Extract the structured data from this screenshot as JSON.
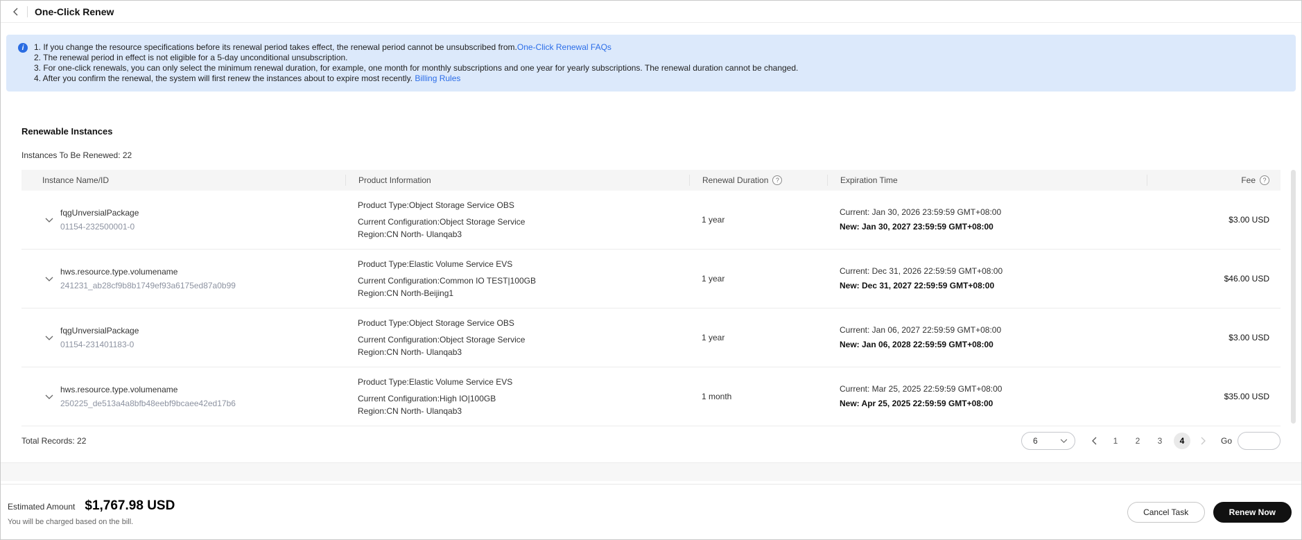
{
  "header": {
    "title": "One-Click Renew"
  },
  "icons": {
    "info": "i",
    "help": "?"
  },
  "notice": {
    "lines": [
      {
        "text": "1. If you change the resource specifications before its renewal period takes effect, the renewal period cannot be unsubscribed from.",
        "link": "One-Click Renewal FAQs"
      },
      {
        "text": "2. The renewal period in effect is not eligible for a 5-day unconditional unsubscription.",
        "link": ""
      },
      {
        "text": "3. For one-click renewals, you can only select the minimum renewal duration, for example, one month for monthly subscriptions and one year for yearly subscriptions. The renewal duration cannot be changed.",
        "link": ""
      },
      {
        "text": "4. After you confirm the renewal, the system will first renew the instances about to expire most recently. ",
        "link": "Billing Rules"
      }
    ]
  },
  "section": {
    "title": "Renewable Instances",
    "subtitle": "Instances To Be Renewed: 22"
  },
  "table": {
    "columns": {
      "name": "Instance Name/ID",
      "product": "Product Information",
      "duration": "Renewal Duration",
      "expiration": "Expiration Time",
      "fee": "Fee"
    },
    "rows": [
      {
        "name": "fqgUnversialPackage",
        "id": "01154-232500001-0",
        "product_type": "Product Type:Object Storage Service OBS",
        "configuration": "Current Configuration:Object Storage Service",
        "region": "Region:CN North- Ulanqab3",
        "duration": "1 year",
        "expiration_current": "Current: Jan 30, 2026 23:59:59 GMT+08:00",
        "expiration_new": "New: Jan 30, 2027 23:59:59 GMT+08:00",
        "fee": "$3.00 USD"
      },
      {
        "name": "hws.resource.type.volumename",
        "id": "241231_ab28cf9b8b1749ef93a6175ed87a0b99",
        "product_type": "Product Type:Elastic Volume Service EVS",
        "configuration": "Current Configuration:Common IO TEST|100GB",
        "region": "Region:CN North-Beijing1",
        "duration": "1 year",
        "expiration_current": "Current: Dec 31, 2026 22:59:59 GMT+08:00",
        "expiration_new": "New: Dec 31, 2027 22:59:59 GMT+08:00",
        "fee": "$46.00 USD"
      },
      {
        "name": "fqgUnversialPackage",
        "id": "01154-231401183-0",
        "product_type": "Product Type:Object Storage Service OBS",
        "configuration": "Current Configuration:Object Storage Service",
        "region": "Region:CN North- Ulanqab3",
        "duration": "1 year",
        "expiration_current": "Current: Jan 06, 2027 22:59:59 GMT+08:00",
        "expiration_new": "New: Jan 06, 2028 22:59:59 GMT+08:00",
        "fee": "$3.00 USD"
      },
      {
        "name": "hws.resource.type.volumename",
        "id": "250225_de513a4a8bfb48eebf9bcaee42ed17b6",
        "product_type": "Product Type:Elastic Volume Service EVS",
        "configuration": "Current Configuration:High IO|100GB",
        "region": "Region:CN North- Ulanqab3",
        "duration": "1 month",
        "expiration_current": "Current: Mar 25, 2025 22:59:59 GMT+08:00",
        "expiration_new": "New: Apr 25, 2025 22:59:59 GMT+08:00",
        "fee": "$35.00 USD"
      }
    ]
  },
  "pagination": {
    "total_label": "Total Records: 22",
    "page_size": "6",
    "pages": [
      "1",
      "2",
      "3",
      "4"
    ],
    "active_page": "4",
    "go_label": "Go"
  },
  "footer": {
    "estimated_label": "Estimated Amount",
    "amount": "$1,767.98 USD",
    "note": "You will be charged based on the bill.",
    "cancel_label": "Cancel Task",
    "renew_label": "Renew Now"
  }
}
